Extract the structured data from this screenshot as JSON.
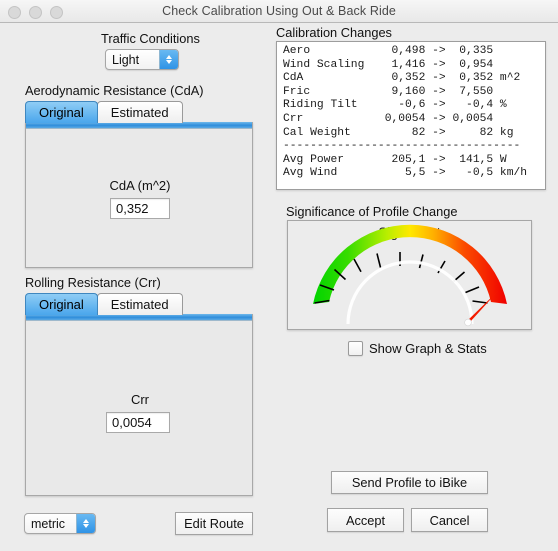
{
  "window": {
    "title": "Check Calibration Using Out & Back Ride",
    "traffic_lights": [
      "close-button",
      "minimize-button",
      "zoom-button"
    ]
  },
  "traffic_conditions": {
    "label": "Traffic Conditions",
    "selected": "Light"
  },
  "aero_section": {
    "label": "Aerodynamic Resistance (CdA)",
    "tabs": [
      {
        "label": "Original",
        "active": true
      },
      {
        "label": "Estimated",
        "active": false
      }
    ],
    "field_label": "CdA (m^2)",
    "field_value": "0,352"
  },
  "crr_section": {
    "label": "Rolling Resistance (Crr)",
    "tabs": [
      {
        "label": "Original",
        "active": true
      },
      {
        "label": "Estimated",
        "active": false
      }
    ],
    "field_label": "Crr",
    "field_value": "0,0054"
  },
  "units": {
    "selected": "metric"
  },
  "edit_route_button": "Edit Route",
  "calibration_changes": {
    "label": "Calibration Changes",
    "rows": [
      {
        "name": "Aero",
        "from": "0,498",
        "to": "0,335",
        "unit": ""
      },
      {
        "name": "Wind Scaling",
        "from": "1,416",
        "to": "0,954",
        "unit": ""
      },
      {
        "name": "CdA",
        "from": "0,352",
        "to": "0,352",
        "unit": "m^2"
      },
      {
        "name": "Fric",
        "from": "9,160",
        "to": "7,550",
        "unit": ""
      },
      {
        "name": "Riding Tilt",
        "from": "-0,6",
        "to": "-0,4",
        "unit": "%"
      },
      {
        "name": "Crr",
        "from": "0,0054",
        "to": "0,0054",
        "unit": ""
      },
      {
        "name": "Cal Weight",
        "from": "82",
        "to": "82",
        "unit": "kg"
      },
      {
        "name": "---",
        "from": "",
        "to": "",
        "unit": ""
      },
      {
        "name": "Avg Power",
        "from": "205,1",
        "to": "141,5",
        "unit": "W"
      },
      {
        "name": "Avg Wind",
        "from": "5,5",
        "to": "-0,5",
        "unit": "km/h"
      }
    ],
    "text": "Aero            0,498 ->  0,335\nWind Scaling    1,416 ->  0,954\nCdA             0,352 ->  0,352 m^2\nFric            9,160 ->  7,550\nRiding Tilt      -0,6 ->   -0,4 %\nCrr            0,0054 -> 0,0054\nCal Weight         82 ->     82 kg\n-----------------------------------\nAvg Power       205,1 ->  141,5 W\nAvg Wind          5,5 ->   -0,5 km/h"
  },
  "significance": {
    "label": "Significance of Profile Change",
    "reading": "Significant",
    "needle_fraction": 0.97,
    "tick_count": 9,
    "colors": {
      "low": "#00d400",
      "mid": "#ffe800",
      "high": "#f00000",
      "needle": "#f41b00"
    }
  },
  "show_graph": {
    "label": "Show Graph & Stats",
    "checked": false
  },
  "buttons": {
    "send_profile": "Send Profile to iBike",
    "accept": "Accept",
    "cancel": "Cancel"
  }
}
